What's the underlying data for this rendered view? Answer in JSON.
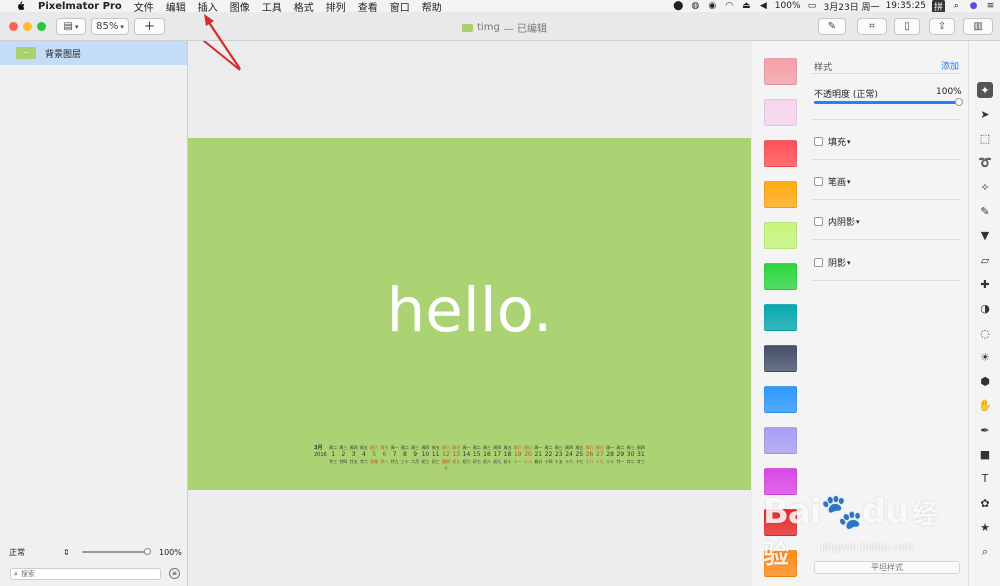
{
  "menubar": {
    "app_name": "Pixelmator Pro",
    "items": [
      "文件",
      "编辑",
      "插入",
      "图像",
      "工具",
      "格式",
      "排列",
      "查看",
      "窗口",
      "帮助"
    ],
    "battery": "100%",
    "datetime": "3月23日 周一",
    "time": "19:35:25",
    "input_method": "拼"
  },
  "titlebar": {
    "zoom": "85%",
    "add_label": "+",
    "title": "timg",
    "edited": "— 已编辑"
  },
  "layers": {
    "items": [
      {
        "label": "背景图层"
      }
    ],
    "blend_mode": "正常",
    "opacity": "100%",
    "search_placeholder": "搜索"
  },
  "canvas": {
    "text": "hello.",
    "bg_color": "#acd373",
    "calendar": {
      "month": "3月",
      "year": "2016",
      "weekdays": [
        "周二",
        "周三",
        "周四",
        "周五",
        "周六",
        "周日",
        "周一",
        "周二",
        "周三",
        "周四",
        "周五",
        "周六",
        "周日",
        "周一",
        "周二",
        "周三",
        "周四",
        "周五",
        "周六",
        "周日",
        "周一",
        "周二",
        "周三",
        "周四",
        "周五",
        "周六",
        "周日",
        "周一",
        "周二",
        "周三",
        "周四"
      ],
      "days": [
        "1",
        "2",
        "3",
        "4",
        "5",
        "6",
        "7",
        "8",
        "9",
        "10",
        "11",
        "12",
        "13",
        "14",
        "15",
        "16",
        "17",
        "18",
        "19",
        "20",
        "21",
        "22",
        "23",
        "24",
        "25",
        "26",
        "27",
        "28",
        "29",
        "30",
        "31"
      ],
      "lunar": [
        "廿三",
        "廿四",
        "廿五",
        "廿六",
        "惊蛰",
        "廿八",
        "廿九",
        "三十",
        "二月",
        "初三",
        "初三",
        "植树节",
        "初五",
        "初六",
        "初七",
        "初八",
        "初九",
        "初十",
        "十一",
        "十二",
        "春分",
        "十四",
        "十五",
        "十六",
        "十七",
        "十八",
        "十九",
        "二十",
        "廿一",
        "廿二",
        "廿三"
      ]
    }
  },
  "swatches": {
    "colors": [
      "#f2a0a6",
      "#f6d4ee",
      "#ff4f55",
      "#ffaa12",
      "#c5f57a",
      "#2cd63f",
      "#06a8ae",
      "#45506a",
      "#2c98ff",
      "#a79ff2",
      "#d946e6",
      "#e62a2a",
      "#ff8a17"
    ]
  },
  "inspector": {
    "styles_label": "样式",
    "add_label": "添加",
    "opacity_label": "不透明度 (正常)",
    "opacity_value": "100%",
    "opacity_fraction": 1.0,
    "sections": [
      {
        "label": "填充"
      },
      {
        "label": "笔画"
      },
      {
        "label": "内阴影"
      },
      {
        "label": "阴影"
      }
    ],
    "flatten_button": "平坦样式"
  },
  "tools": [
    "style-tool-icon",
    "arrow-select-icon",
    "rect-select-icon",
    "lasso-icon",
    "magic-wand-icon",
    "paint-brush-icon",
    "paint-bucket-icon",
    "eraser-icon",
    "bandage-icon",
    "smudge-icon",
    "blur-icon",
    "light-icon",
    "sponge-icon",
    "warp-icon",
    "pen-icon",
    "shape-icon",
    "type-icon",
    "effects-icon",
    "color-adjust-icon",
    "zoom-icon"
  ],
  "watermark": {
    "brand": "Bai",
    "brand2": "du",
    "suffix": "经验",
    "url": "jingyan.baidu.com"
  },
  "annotation": {
    "color": "#d62b2b"
  }
}
